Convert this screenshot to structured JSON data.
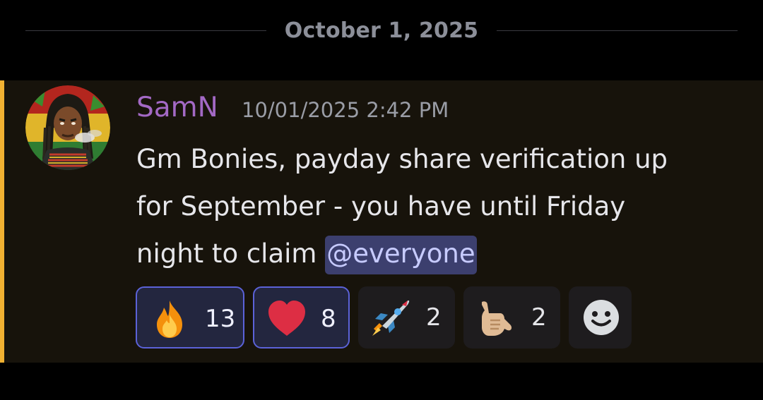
{
  "date_divider": {
    "label": "October 1, 2025"
  },
  "message": {
    "author": "SamN",
    "timestamp": "10/01/2025 2:42 PM",
    "content_lines": [
      "Gm Bonies, payday share verification up",
      "for September - you have until Friday",
      "night to claim "
    ],
    "mention": "@everyone",
    "accent_color": "#f0b132",
    "author_color": "#a369c5"
  },
  "reactions": [
    {
      "emoji": "fire-emoji",
      "count": "13",
      "reacted_by_me": true
    },
    {
      "emoji": "red-heart-emoji",
      "count": "8",
      "reacted_by_me": true
    },
    {
      "emoji": "rocket-emoji",
      "count": "2",
      "reacted_by_me": false
    },
    {
      "emoji": "call-me-hand-emoji",
      "count": "2",
      "reacted_by_me": false
    }
  ],
  "add_reaction": {
    "icon": "add-reaction-smiley-icon"
  }
}
